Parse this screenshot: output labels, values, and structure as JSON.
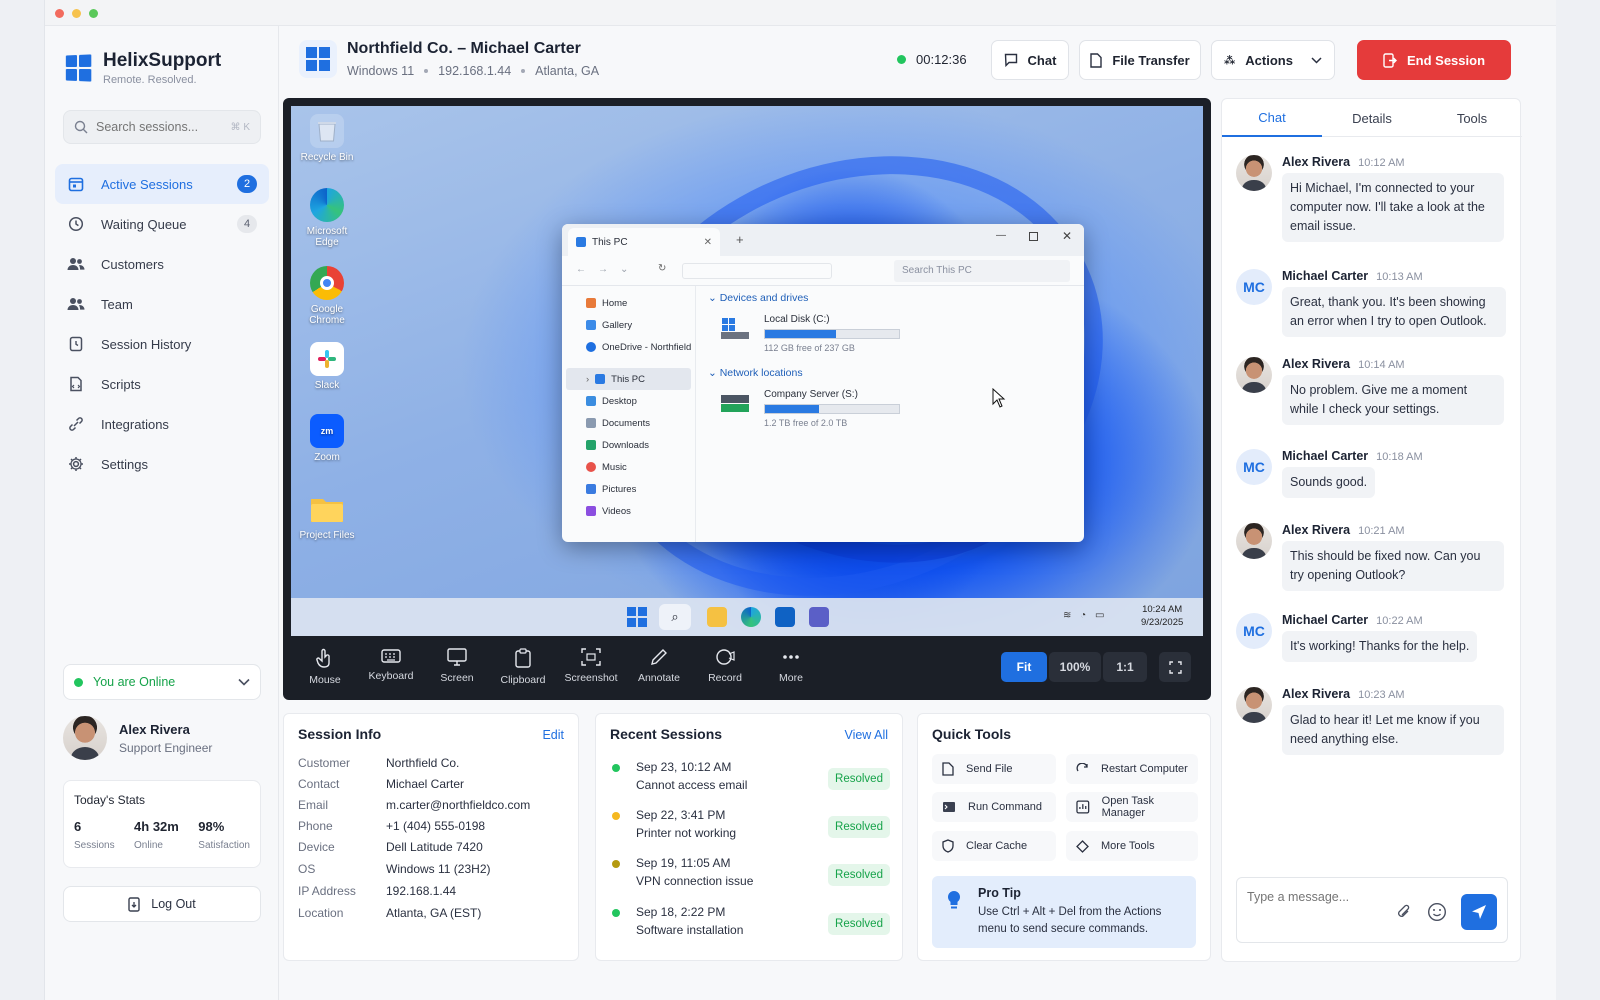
{
  "app": {
    "name": "HelixSupport",
    "tagline": "Remote. Resolved."
  },
  "colors": {
    "accent": "#1f6fe0",
    "danger": "#e53b3b",
    "online": "#22c55e",
    "resolved": "#16a34a"
  },
  "sidebar": {
    "search_placeholder": "Search sessions...",
    "search_shortcut": "⌘ K",
    "items": [
      {
        "label": "Active Sessions",
        "badge": "2",
        "icon": "active-sessions-icon"
      },
      {
        "label": "Waiting Queue",
        "badge": "4",
        "icon": "clock-icon"
      },
      {
        "label": "Customers",
        "icon": "users-icon"
      },
      {
        "label": "Team",
        "icon": "team-icon"
      },
      {
        "label": "Session History",
        "icon": "history-icon"
      },
      {
        "label": "Scripts",
        "icon": "script-icon"
      },
      {
        "label": "Integrations",
        "icon": "integrations-icon"
      },
      {
        "label": "Settings",
        "icon": "gear-icon"
      }
    ],
    "status": "You are Online",
    "user": {
      "name": "Alex Rivera",
      "role": "Support Engineer"
    },
    "stats": {
      "title": "Today's Stats",
      "items": [
        {
          "value": "6",
          "label": "Sessions"
        },
        {
          "value": "4h 32m",
          "label": "Online"
        },
        {
          "value": "98%",
          "label": "Satisfaction"
        }
      ]
    },
    "logout": "Log Out"
  },
  "header": {
    "title": "Northfield Co. – Michael Carter",
    "os": "Windows 11",
    "ip": "192.168.1.44",
    "location": "Atlanta, GA",
    "timer": "00:12:36",
    "chat": "Chat",
    "file_transfer": "File Transfer",
    "actions": "Actions",
    "end_session": "End Session"
  },
  "remote": {
    "desktop_icons": [
      "Recycle Bin",
      "Microsoft Edge",
      "Google Chrome",
      "Slack",
      "Zoom",
      "Project Files"
    ],
    "explorer": {
      "tab": "This PC",
      "search_placeholder": "Search This PC",
      "nav": [
        "Home",
        "Gallery",
        "OneDrive - Northfield",
        "This PC",
        "Desktop",
        "Documents",
        "Downloads",
        "Music",
        "Pictures",
        "Videos"
      ],
      "devices_header": "Devices and drives",
      "network_header": "Network locations",
      "drives": [
        {
          "name": "Local Disk (C:)",
          "free": "112 GB free of 237 GB",
          "used_fraction": 0.53
        },
        {
          "name": "Company Server (S:)",
          "free": "1.2 TB free of 2.0 TB",
          "used_fraction": 0.4
        }
      ]
    },
    "clock": {
      "time": "10:24 AM",
      "date": "9/23/2025"
    },
    "tools": [
      "Mouse",
      "Keyboard",
      "Screen",
      "Clipboard",
      "Screenshot",
      "Annotate",
      "Record",
      "More"
    ],
    "zoom": {
      "fit": "Fit",
      "percent": "100%",
      "ratio": "1:1"
    }
  },
  "session_info": {
    "title": "Session Info",
    "edit": "Edit",
    "rows": [
      {
        "k": "Customer",
        "v": "Northfield Co."
      },
      {
        "k": "Contact",
        "v": "Michael Carter"
      },
      {
        "k": "Email",
        "v": "m.carter@northfieldco.com"
      },
      {
        "k": "Phone",
        "v": "+1 (404) 555-0198"
      },
      {
        "k": "Device",
        "v": "Dell Latitude 7420"
      },
      {
        "k": "OS",
        "v": "Windows 11 (23H2)"
      },
      {
        "k": "IP Address",
        "v": "192.168.1.44"
      },
      {
        "k": "Location",
        "v": "Atlanta, GA (EST)"
      }
    ]
  },
  "recent_sessions": {
    "title": "Recent Sessions",
    "view_all": "View All",
    "items": [
      {
        "date": "Sep 23, 10:12 AM",
        "desc": "Cannot access email",
        "status": "Resolved",
        "dot": "#22c55e"
      },
      {
        "date": "Sep 22, 3:41 PM",
        "desc": "Printer not working",
        "status": "Resolved",
        "dot": "#f5b820"
      },
      {
        "date": "Sep 19, 11:05 AM",
        "desc": "VPN connection issue",
        "status": "Resolved",
        "dot": "#b59a10"
      },
      {
        "date": "Sep 18, 2:22 PM",
        "desc": "Software installation",
        "status": "Resolved",
        "dot": "#22c55e"
      }
    ]
  },
  "quick_tools": {
    "title": "Quick Tools",
    "items": [
      "Send File",
      "Restart Computer",
      "Run Command",
      "Open Task Manager",
      "Clear Cache",
      "More Tools"
    ],
    "tip_title": "Pro Tip",
    "tip_text": "Use Ctrl + Alt + Del from the Actions menu to send secure commands."
  },
  "chat": {
    "tabs": [
      "Chat",
      "Details",
      "Tools"
    ],
    "messages": [
      {
        "name": "Alex Rivera",
        "time": "10:12 AM",
        "text": "Hi Michael, I'm connected to your computer now. I'll take a look at the email issue.",
        "agent": true
      },
      {
        "name": "Michael Carter",
        "time": "10:13 AM",
        "text": "Great, thank you. It's been showing an error when I try to open Outlook.",
        "initials": "MC"
      },
      {
        "name": "Alex Rivera",
        "time": "10:14 AM",
        "text": "No problem. Give me a moment while I check your settings.",
        "agent": true
      },
      {
        "name": "Michael Carter",
        "time": "10:18 AM",
        "text": "Sounds good.",
        "initials": "MC"
      },
      {
        "name": "Alex Rivera",
        "time": "10:21 AM",
        "text": "This should be fixed now. Can you try opening Outlook?",
        "agent": true
      },
      {
        "name": "Michael Carter",
        "time": "10:22 AM",
        "text": "It's working! Thanks for the help.",
        "initials": "MC"
      },
      {
        "name": "Alex Rivera",
        "time": "10:23 AM",
        "text": "Glad to hear it! Let me know if you need anything else.",
        "agent": true
      }
    ],
    "placeholder": "Type a message..."
  }
}
